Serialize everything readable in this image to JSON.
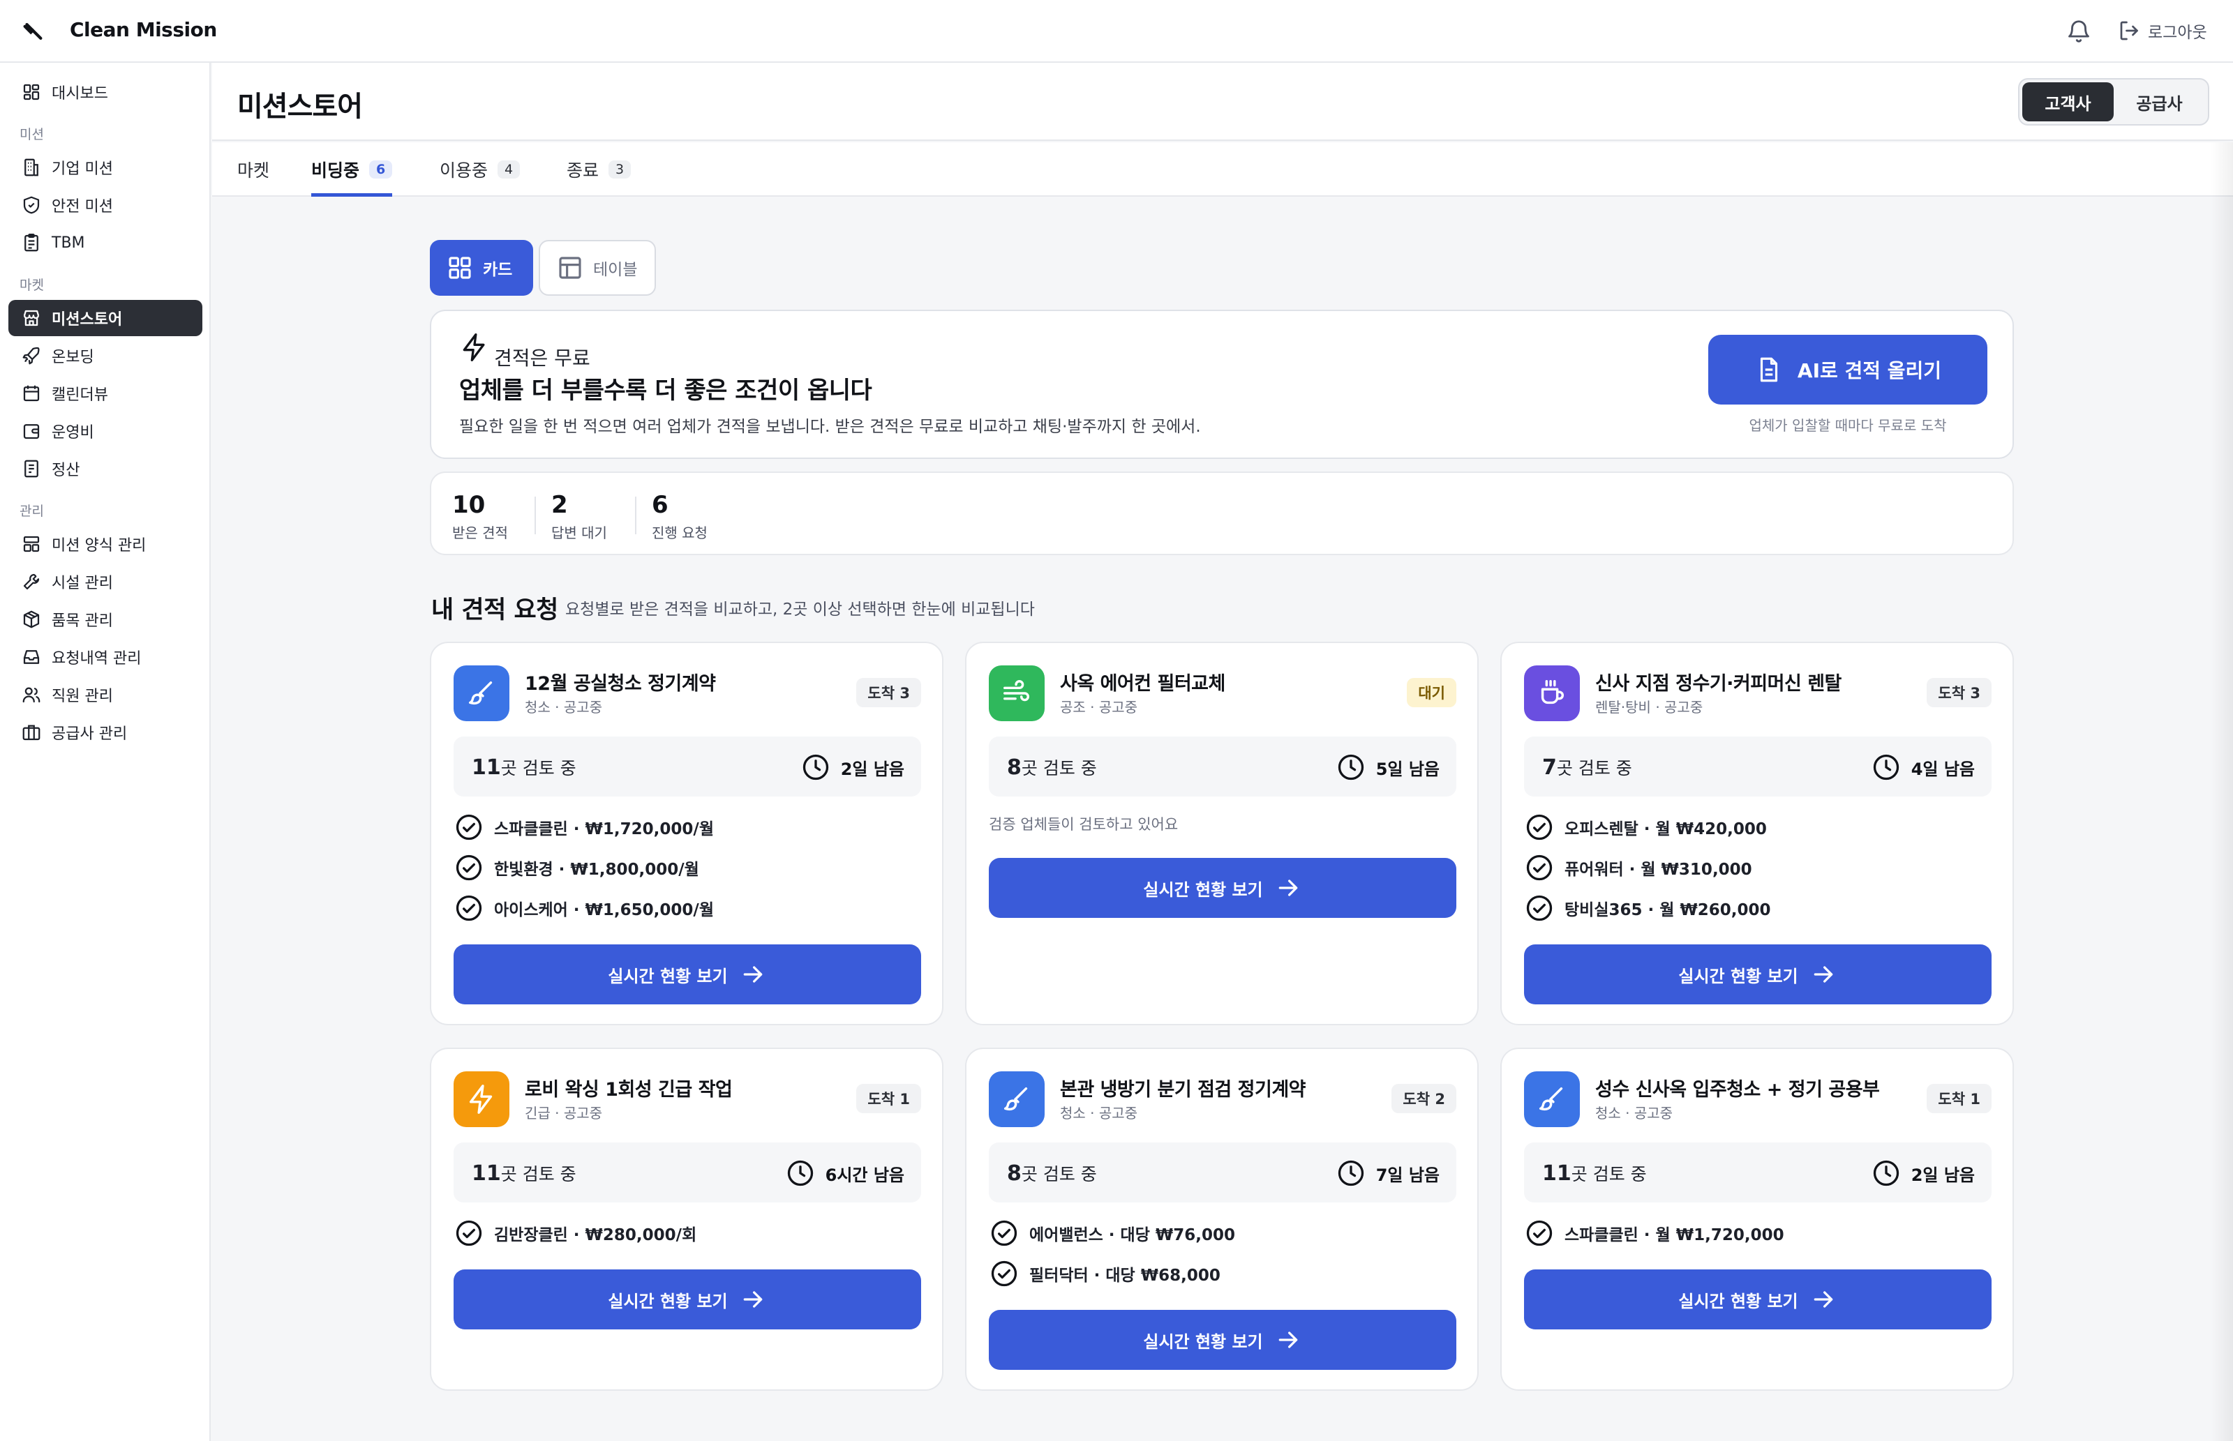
{
  "app": {
    "brand": "Clean Mission",
    "logout_label": "로그아웃"
  },
  "sidebar": {
    "dashboard": "대시보드",
    "section_mission": "미션",
    "corporate_mission": "기업 미션",
    "safety_mission": "안전 미션",
    "tbm": "TBM",
    "section_market": "마켓",
    "mission_store": "미션스토어",
    "onboarding": "온보딩",
    "calendar": "캘린더뷰",
    "operating_cost": "운영비",
    "settlement": "정산",
    "section_manage": "관리",
    "form_manage": "미션 양식 관리",
    "facility_manage": "시설 관리",
    "item_manage": "품목 관리",
    "request_manage": "요청내역 관리",
    "staff_manage": "직원 관리",
    "supplier_manage": "공급사 관리"
  },
  "header": {
    "title": "미션스토어",
    "role_customer": "고객사",
    "role_supplier": "공급사"
  },
  "tabs": [
    {
      "label": "마켓",
      "count": ""
    },
    {
      "label": "비딩중",
      "count": "6"
    },
    {
      "label": "이용중",
      "count": "4"
    },
    {
      "label": "종료",
      "count": "3"
    }
  ],
  "view": {
    "card": "카드",
    "table": "테이블"
  },
  "promo": {
    "kicker": "견적은 무료",
    "title": "업체를 더 부를수록 더 좋은 조건이 옵니다",
    "desc": "필요한 일을 한 번 적으면 여러 업체가 견적을 보냅니다. 받은 견적은 무료로 비교하고 채팅·발주까지 한 곳에서.",
    "button": "AI로 견적 올리기",
    "note": "업체가 입찰할 때마다 무료로 도착"
  },
  "stats": [
    {
      "num": "10",
      "label": "받은 견적"
    },
    {
      "num": "2",
      "label": "답변 대기"
    },
    {
      "num": "6",
      "label": "진행 요청"
    }
  ],
  "section": {
    "title": "내 견적 요청",
    "subtitle": "요청별로 받은 견적을 비교하고, 2곳 이상 선택하면 한눈에 비교됩니다"
  },
  "colors": {
    "primary": "#3a5bd9",
    "blue_icon": "#3b74e6",
    "green_icon": "#2fb85c",
    "purple_icon": "#6a4fe0",
    "orange_icon": "#f59a0c"
  },
  "cards": [
    {
      "icon": "brush-icon",
      "title": "12월 공실청소 정기계약",
      "meta": "청소 · 공고중",
      "badge": "도착 3",
      "review_num": "11",
      "review_suffix": "곳 검토 중",
      "time": "2일 남음",
      "bids": [
        "스파클클린 · ₩1,720,000/월",
        "한빛환경 · ₩1,800,000/월",
        "아이스케어 · ₩1,650,000/월"
      ],
      "cta": "실시간 현황 보기"
    },
    {
      "icon": "wind-icon",
      "title": "사옥 에어컨 필터교체",
      "meta": "공조 · 공고중",
      "badge": "대기",
      "review_num": "8",
      "review_suffix": "곳 검토 중",
      "time": "5일 남음",
      "note": "검증 업체들이 검토하고 있어요",
      "cta": "실시간 현황 보기"
    },
    {
      "icon": "coffee-icon",
      "title": "신사 지점 정수기·커피머신 렌탈",
      "meta": "렌탈·탕비 · 공고중",
      "badge": "도착 3",
      "review_num": "7",
      "review_suffix": "곳 검토 중",
      "time": "4일 남음",
      "bids": [
        "오피스렌탈 · 월 ₩420,000",
        "퓨어워터 · 월 ₩310,000",
        "탕비실365 · 월 ₩260,000"
      ],
      "cta": "실시간 현황 보기"
    },
    {
      "icon": "bolt-icon",
      "title": "로비 왁싱 1회성 긴급 작업",
      "meta": "긴급 · 공고중",
      "badge": "도착 1",
      "review_num": "11",
      "review_suffix": "곳 검토 중",
      "time": "6시간 남음",
      "bids": [
        "김반장클린 · ₩280,000/회"
      ],
      "cta": "실시간 현황 보기"
    },
    {
      "icon": "brush-icon",
      "title": "본관 냉방기 분기 점검 정기계약",
      "meta": "청소 · 공고중",
      "badge": "도착 2",
      "review_num": "8",
      "review_suffix": "곳 검토 중",
      "time": "7일 남음",
      "bids": [
        "에어밸런스 · 대당 ₩76,000",
        "필터닥터 · 대당 ₩68,000"
      ],
      "cta": "실시간 현황 보기"
    },
    {
      "icon": "brush-icon",
      "title": "성수 신사옥 입주청소 + 정기 공용부",
      "meta": "청소 · 공고중",
      "badge": "도착 1",
      "review_num": "11",
      "review_suffix": "곳 검토 중",
      "time": "2일 남음",
      "bids": [
        "스파클클린 · 월 ₩1,720,000"
      ],
      "cta": "실시간 현황 보기"
    }
  ]
}
